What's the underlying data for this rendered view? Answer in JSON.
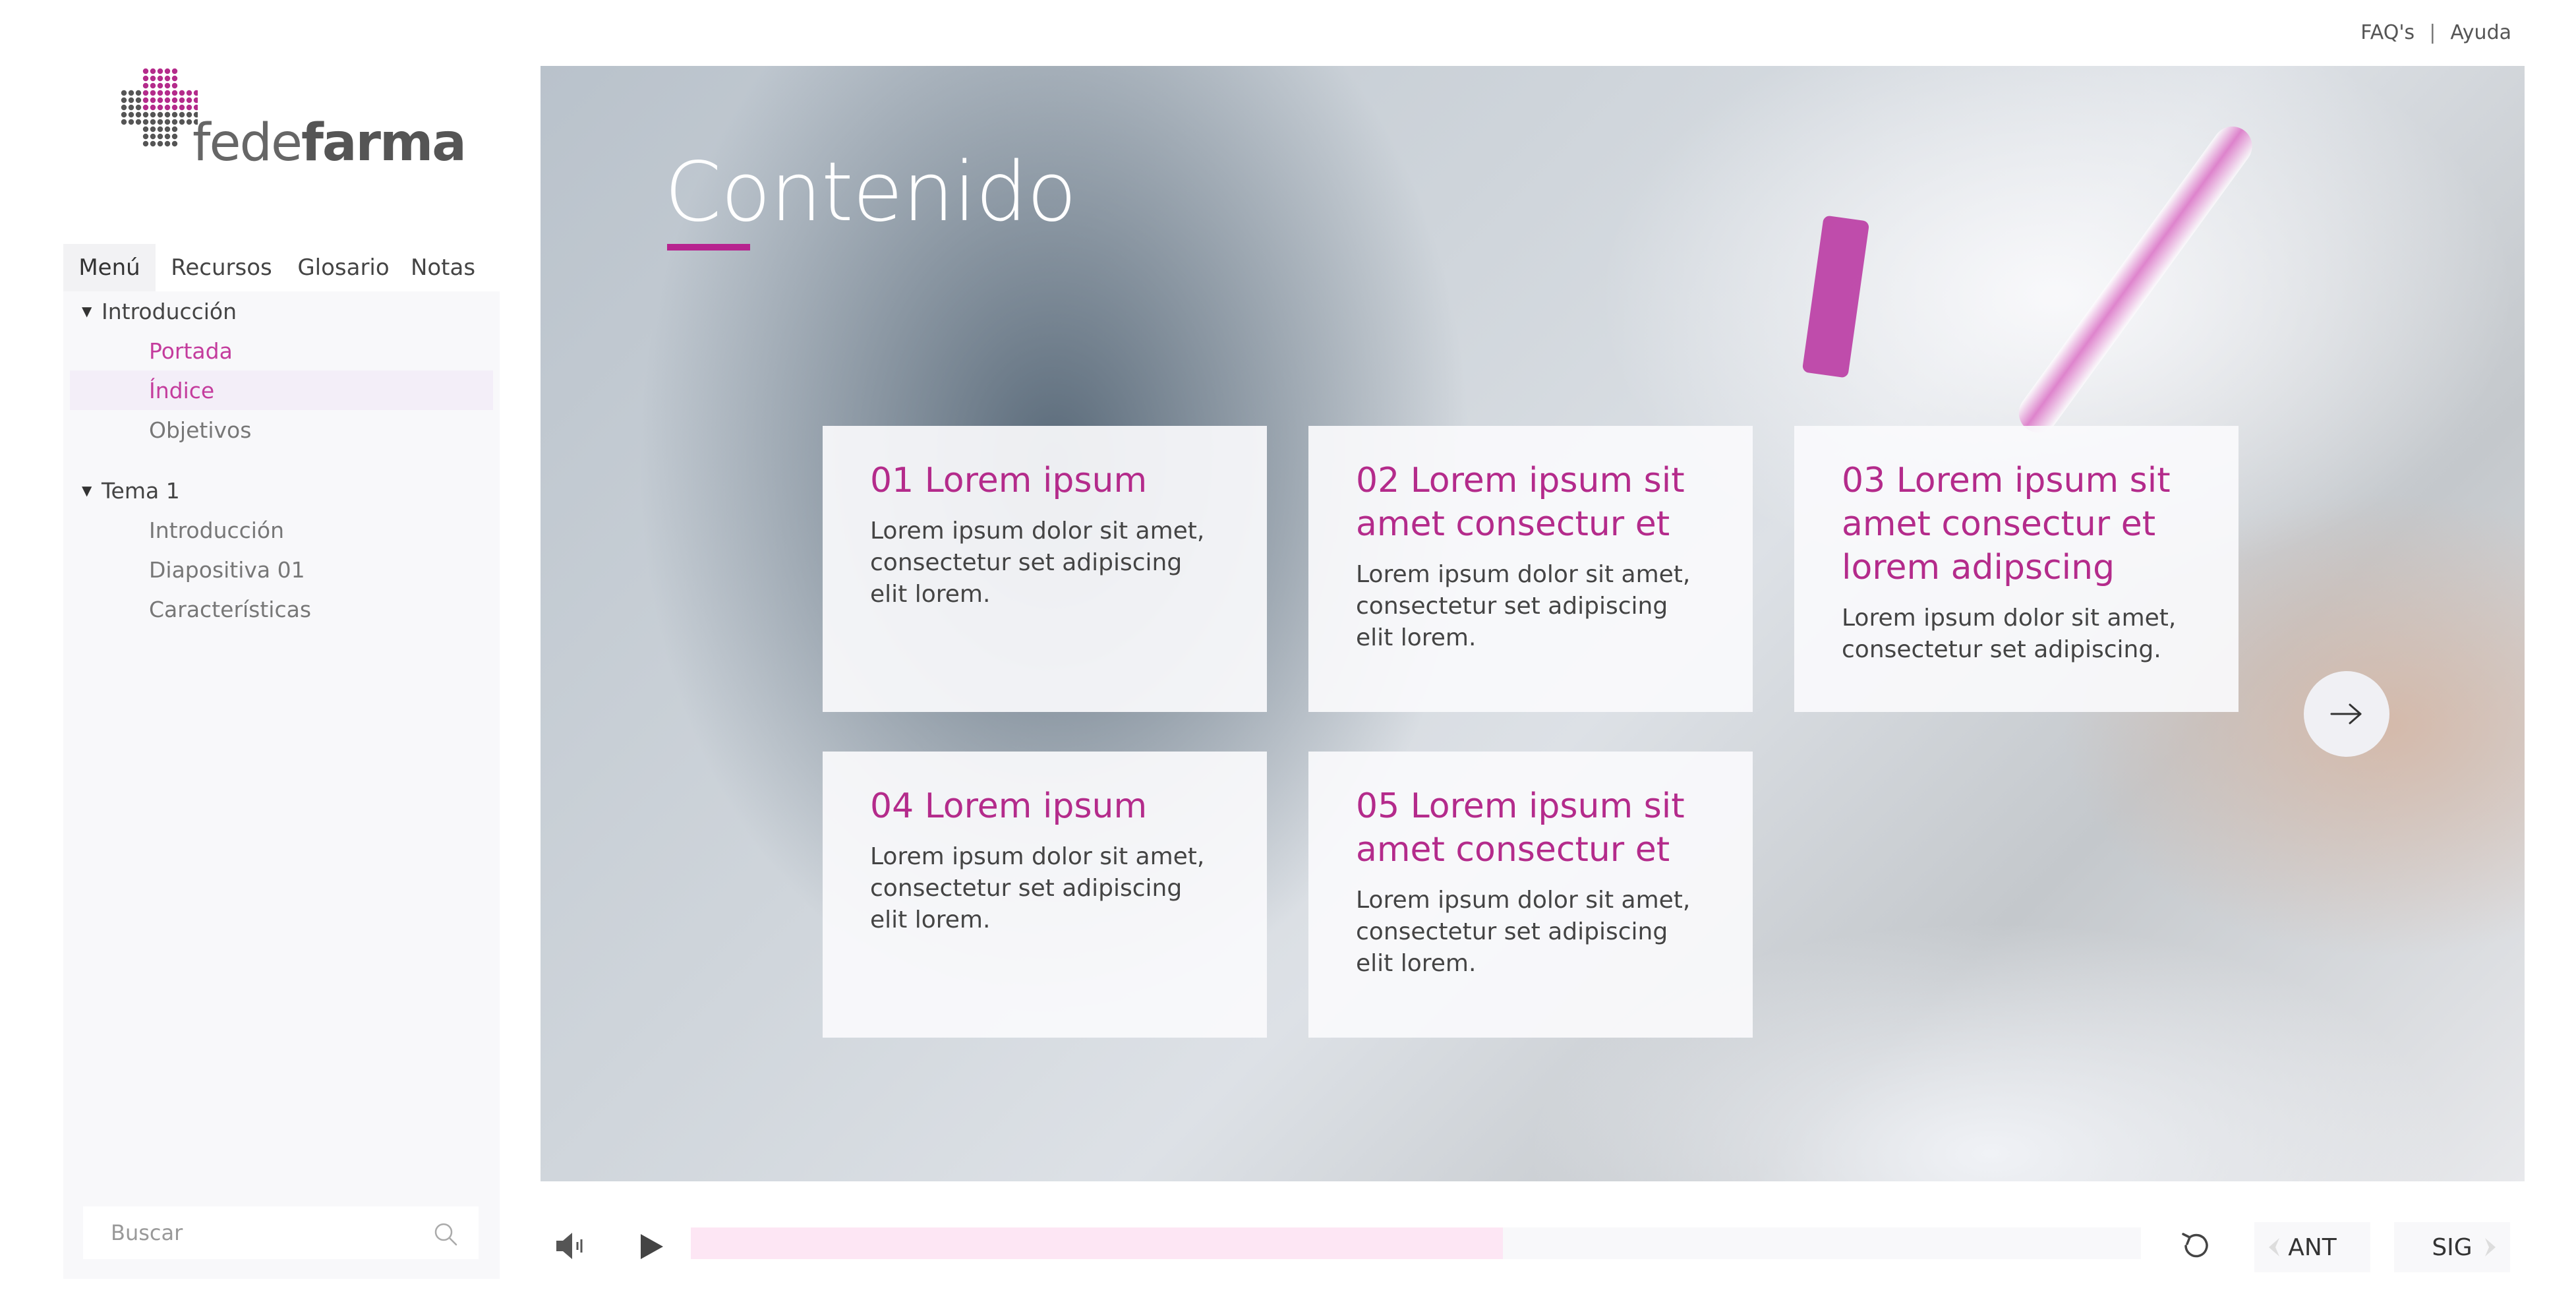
{
  "top_links": {
    "faq": "FAQ's",
    "separator": "|",
    "help": "Ayuda"
  },
  "logo": {
    "light": "fede",
    "bold": "farma"
  },
  "tabs": [
    {
      "label": "Menú",
      "active": true
    },
    {
      "label": "Recursos",
      "active": false
    },
    {
      "label": "Glosario",
      "active": false
    },
    {
      "label": "Notas",
      "active": false
    }
  ],
  "tree": {
    "groups": [
      {
        "title": "Introducción",
        "items": [
          {
            "label": "Portada"
          },
          {
            "label": "Índice"
          },
          {
            "label": "Objetivos"
          }
        ]
      },
      {
        "title": "Tema 1",
        "items": [
          {
            "label": "Introducción"
          },
          {
            "label": "Diapositiva 01"
          },
          {
            "label": "Características"
          }
        ]
      }
    ]
  },
  "search": {
    "placeholder": "Buscar"
  },
  "stage": {
    "title": "Contenido"
  },
  "cards": [
    {
      "title": "01 Lorem ipsum",
      "text": "Lorem ipsum dolor sit amet, consectetur set adipiscing elit lorem."
    },
    {
      "title": "02 Lorem ipsum sit amet consectur et",
      "text": "Lorem ipsum dolor sit amet, consectetur set adipiscing elit lorem."
    },
    {
      "title": "03 Lorem ipsum sit amet consectur et lorem adipscing",
      "text": "Lorem ipsum dolor sit amet, consectetur set adipiscing."
    },
    {
      "title": "04 Lorem ipsum",
      "text": "Lorem ipsum dolor sit amet, consectetur set adipiscing elit lorem."
    },
    {
      "title": "05 Lorem ipsum sit amet consectur et",
      "text": "Lorem ipsum dolor sit amet, consectetur set adipiscing elit lorem."
    }
  ],
  "controls": {
    "progress": 0.56,
    "prev_label": "ANT",
    "next_label": "SIG"
  },
  "colors": {
    "accent": "#b42b8b",
    "progress_fill": "#fde6f4",
    "sidebar_bg": "#f8f8fa"
  }
}
